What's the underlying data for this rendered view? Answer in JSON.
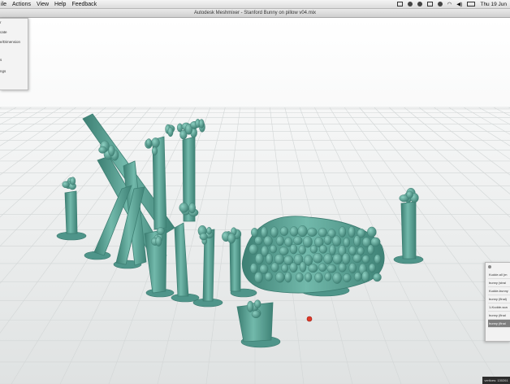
{
  "menubar": {
    "items": [
      "ile",
      "Actions",
      "View",
      "Help",
      "Feedback"
    ],
    "clock": "Thu 19 Jun"
  },
  "window": {
    "title": "Autodesk Meshmixer - Stanford Bunny on pillow v04.mix"
  },
  "left_panel": {
    "items": [
      "r",
      "cate",
      "e/Dimension",
      "s",
      "ngs"
    ]
  },
  "right_panel": {
    "objects": [
      "Kudde.all (m",
      "bunny (strai",
      "Kudde-bunny",
      "bunny (final)",
      "1-Kudde-sca",
      "bunny (final",
      "bunny (final"
    ],
    "selected_index": 6
  },
  "status": {
    "text": "vertices: 130261"
  },
  "colors": {
    "model": "#5fa99c",
    "model_dark": "#3d7f73",
    "marker": "#e03a2a"
  }
}
